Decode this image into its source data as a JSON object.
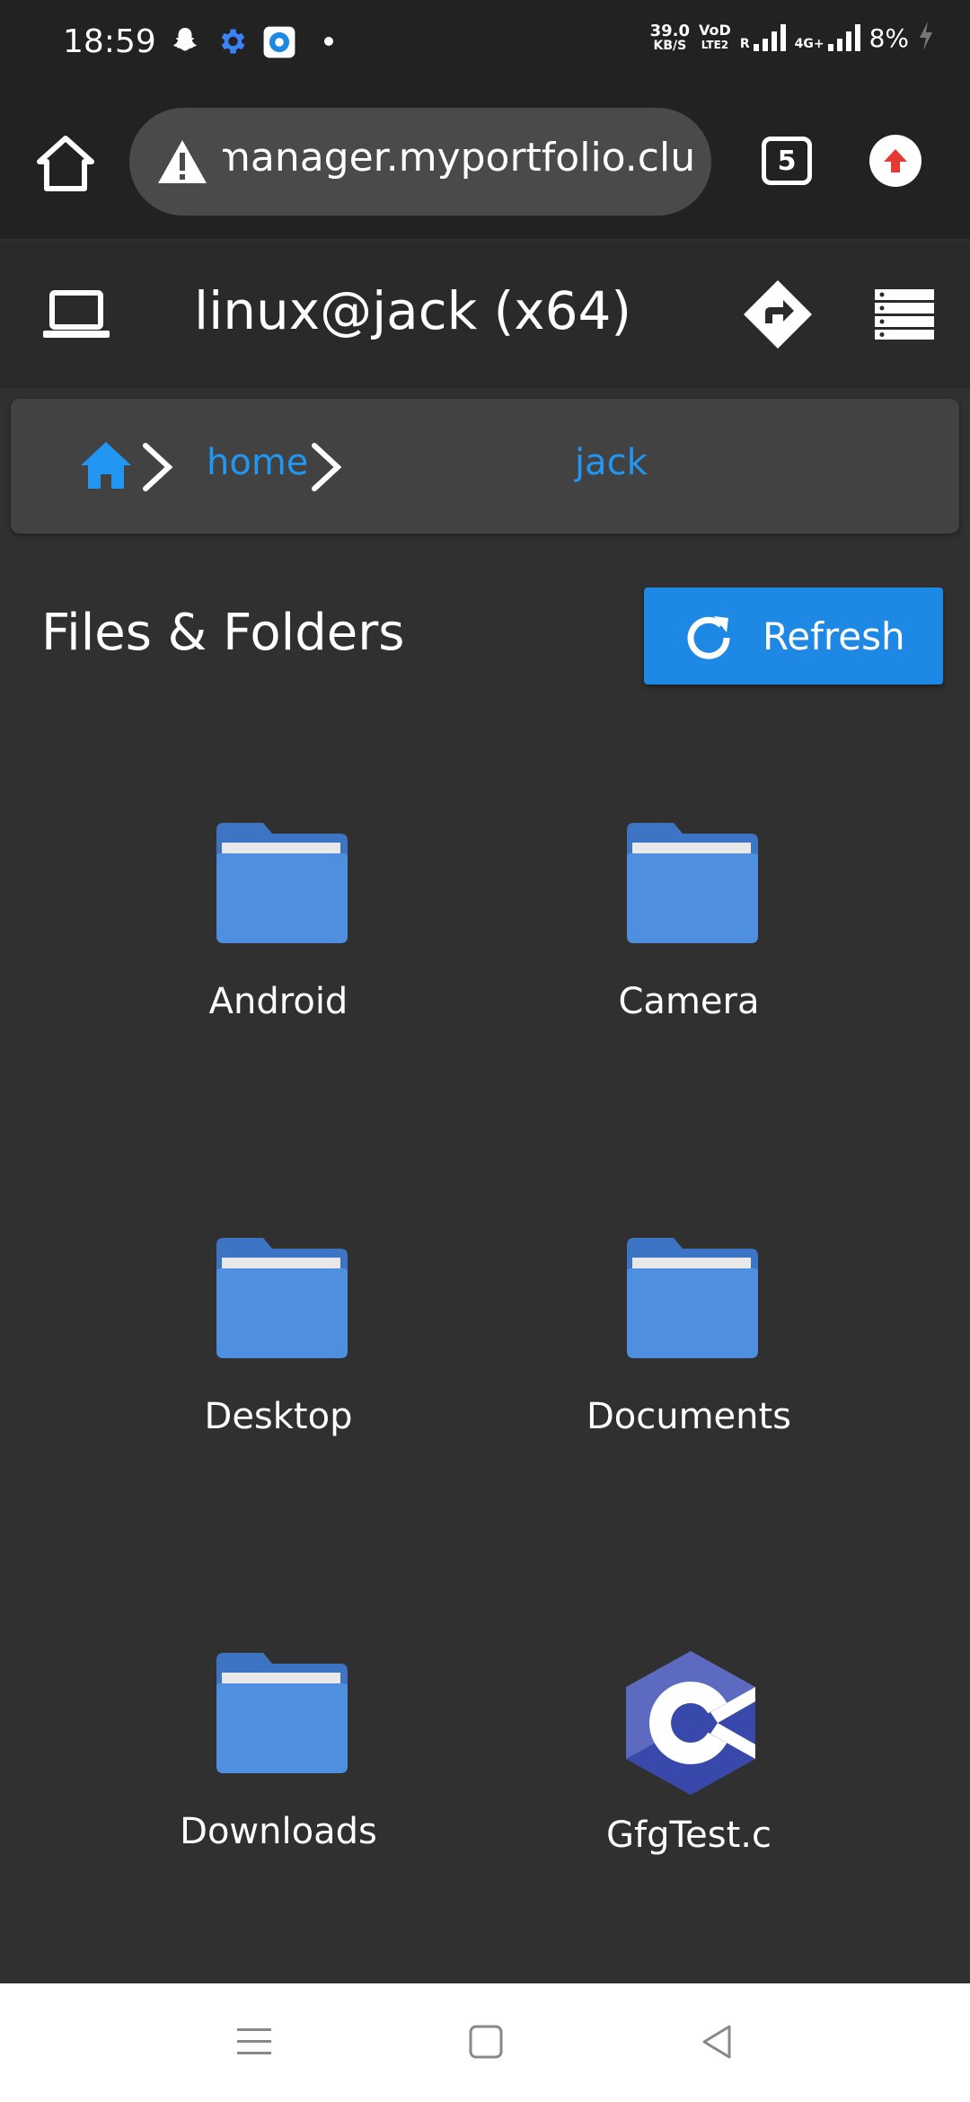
{
  "status_bar": {
    "time": "18:59",
    "net_speed_value": "39.0",
    "net_speed_unit": "KB/S",
    "vo_lte_top": "VoD",
    "vo_lte_bottom": "LTE2",
    "roaming": "R",
    "net_type": "4G+",
    "battery": "8%",
    "notifications": [
      "snapchat-icon",
      "settings-gear-icon",
      "app-icon",
      "dot-icon"
    ]
  },
  "browser": {
    "url": "manager.myportfolio.club",
    "tab_count": "5",
    "colors": {
      "bar": "#222222",
      "url_box": "#4a4a4a",
      "extension": "#e53935"
    }
  },
  "header": {
    "title": "linux@jack (x64)"
  },
  "breadcrumb": {
    "items": [
      "home",
      "jack"
    ]
  },
  "main": {
    "section_title": "Files & Folders",
    "refresh_label": "Refresh",
    "items": [
      {
        "name": "Android",
        "type": "folder"
      },
      {
        "name": "Camera",
        "type": "folder"
      },
      {
        "name": "Desktop",
        "type": "folder"
      },
      {
        "name": "Documents",
        "type": "folder"
      },
      {
        "name": "Downloads",
        "type": "folder"
      },
      {
        "name": "GfgTest.c",
        "type": "c-file"
      }
    ]
  },
  "colors": {
    "accent": "#2196f3",
    "button": "#1e88e5",
    "folder": "#4f8fdf",
    "background": "#303030"
  }
}
